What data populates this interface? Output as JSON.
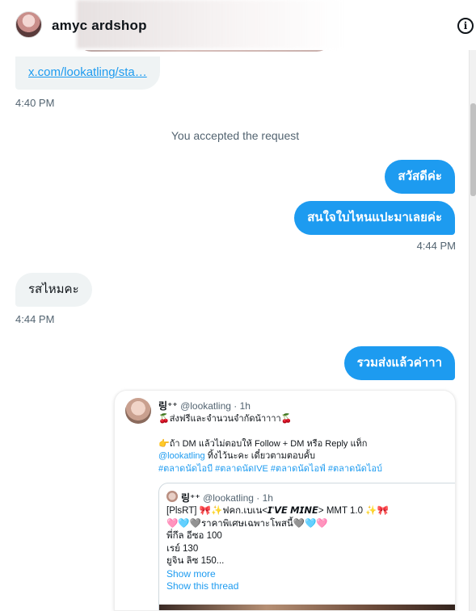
{
  "header": {
    "title": "amyc  ardshop"
  },
  "icons": {
    "info": "info-icon",
    "avatar": "avatar"
  },
  "messages": {
    "link_text": "x.com/lookatling/sta…",
    "link_time": "4:40 PM",
    "system_text": "You accepted the request",
    "out1": "สวัสดีค่ะ",
    "out2": "สนใจใบไหนแปะมาเลยค่ะ",
    "out_time": "4:44 PM",
    "in1": "รสไหมคะ",
    "in_time": "4:44 PM",
    "out3": "รวมส่งแล้วค่าาา"
  },
  "quote": {
    "name": "링⁺⁺",
    "handle": "@lookatling · 1h",
    "line1": "🍒ส่งฟรีและจำนวนจำกัดน้าาาา🍒",
    "line2": "👉ถ้า DM แล้วไม่ตอบให้ Follow + DM หรือ Reply แท็ก",
    "mention": "@lookatling",
    "line3_rest": " ทิ้งไว้นะคะ เดี๋ยวตามตอบคั้บ",
    "hashtags": "#ตลาดนัดไอบี #ตลาดนัดIVE #ตลาดนัดไอฟ์ #ตลาดนัดไอบ์",
    "inner": {
      "name": "링⁺⁺",
      "handle": "@lookatling · 1h",
      "line1": "[PlsRT] 🎀✨ฟคก.เบเน<𝙄'𝙑𝙀 𝙈𝙄𝙉𝙀> MMT 1.0 ✨🎀",
      "line2": "🩷🩵🩶ราคาพิเศษเฉพาะโพสนี้🩶🩵🩷",
      "line3": "พี่กึล อีซอ 100",
      "line4": "เรย์ 130",
      "line5": "ยูจิน ลิซ 150...",
      "show_more": "Show more",
      "show_thread": "Show this thread"
    }
  }
}
